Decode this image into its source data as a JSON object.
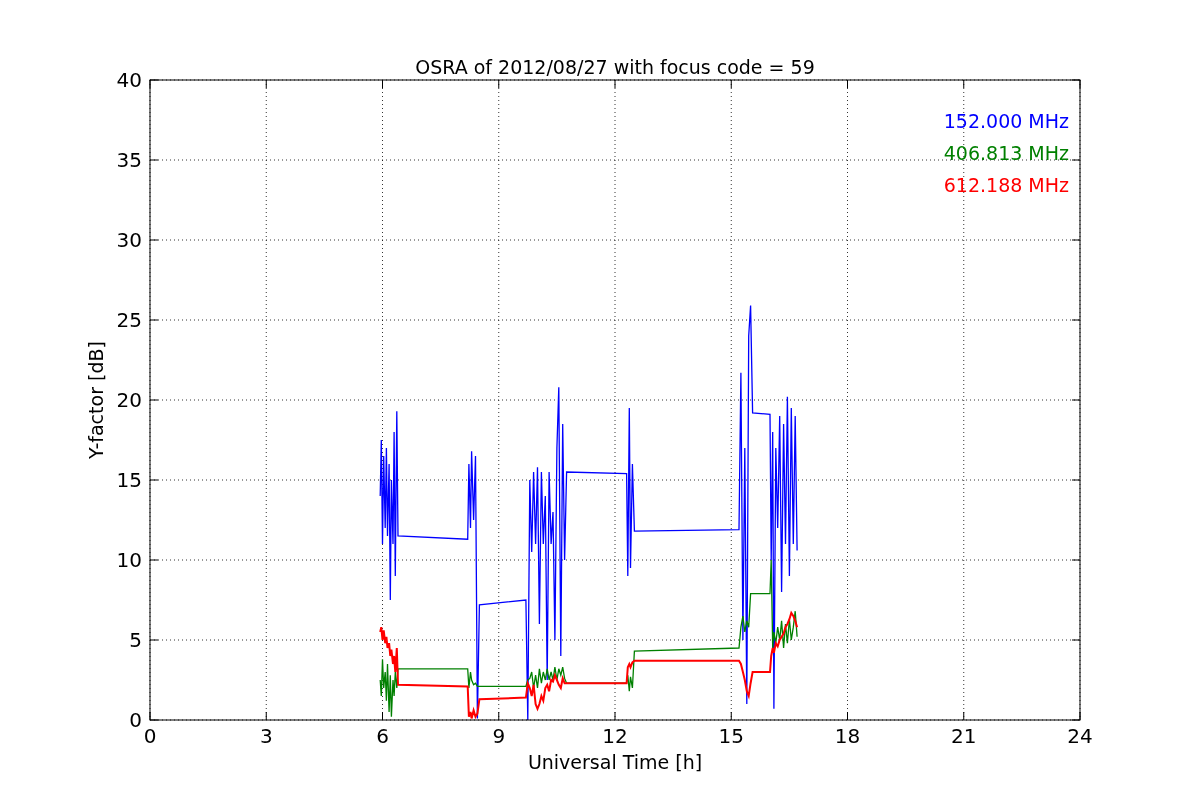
{
  "figure": {
    "chart_data": {
      "type": "line",
      "title": "OSRA of 2012/08/27 with focus code = 59",
      "xlabel": "Universal Time [h]",
      "ylabel": "Y-factor [dB]",
      "xlim": [
        0,
        24
      ],
      "ylim": [
        0,
        40
      ],
      "xticks": [
        0,
        3,
        6,
        9,
        12,
        15,
        18,
        21,
        24
      ],
      "yticks": [
        0,
        5,
        10,
        15,
        20,
        25,
        30,
        35,
        40
      ],
      "grid": true,
      "x": [
        5.94,
        5.97,
        6.0,
        6.03,
        6.07,
        6.1,
        6.13,
        6.17,
        6.2,
        6.23,
        6.27,
        6.3,
        6.33,
        6.37,
        6.4,
        8.2,
        8.23,
        8.27,
        8.3,
        8.35,
        8.4,
        8.45,
        8.5,
        9.7,
        9.75,
        9.8,
        9.85,
        9.9,
        9.95,
        10.0,
        10.05,
        10.1,
        10.15,
        10.2,
        10.25,
        10.3,
        10.35,
        10.4,
        10.45,
        10.5,
        10.55,
        10.6,
        10.65,
        10.7,
        10.75,
        12.3,
        12.33,
        12.37,
        12.4,
        12.45,
        12.5,
        15.2,
        15.25,
        15.3,
        15.35,
        15.4,
        15.45,
        15.5,
        15.55,
        16.0,
        16.03,
        16.07,
        16.1,
        16.15,
        16.2,
        16.25,
        16.3,
        16.35,
        16.4,
        16.45,
        16.5,
        16.55,
        16.6,
        16.65,
        16.7
      ],
      "series": [
        {
          "name": "152.000 MHz",
          "color": "#0000ff",
          "values": [
            14,
            17.5,
            11,
            16.5,
            12,
            17,
            11.5,
            16,
            7.5,
            15,
            11,
            18,
            9,
            19.3,
            11.5,
            11.3,
            16,
            12,
            16.8,
            12.5,
            16.5,
            0.1,
            7.2,
            7.5,
            0,
            15,
            10.5,
            15.5,
            11,
            15.8,
            6,
            15.5,
            11,
            14,
            2.5,
            15.5,
            11,
            13,
            5,
            17,
            20.8,
            4,
            18.5,
            10,
            15.5,
            15.4,
            9,
            19.5,
            9.5,
            16,
            11.8,
            11.9,
            21.7,
            5,
            17,
            1,
            24,
            25.9,
            19.2,
            19.1,
            10,
            18,
            0.7,
            17,
            12,
            19,
            8,
            18.5,
            11,
            20.2,
            9,
            19.5,
            11,
            19,
            10.6
          ]
        },
        {
          "name": "406.813 MHz",
          "color": "#008000",
          "values": [
            2.5,
            1.5,
            3.8,
            2.0,
            3.0,
            1.2,
            3.5,
            0.5,
            2.8,
            0.2,
            2.5,
            1.5,
            3.0,
            2.0,
            3.2,
            3.2,
            2.0,
            3.0,
            2.5,
            2.2,
            2.3,
            2.1,
            2.1,
            2.1,
            2.5,
            2.6,
            3.0,
            2.0,
            2.8,
            2.0,
            3.2,
            2.3,
            3.0,
            2.5,
            3.2,
            2.5,
            3.0,
            2.5,
            3.3,
            2.5,
            3.2,
            2.8,
            3.3,
            2.6,
            2.3,
            2.3,
            2.8,
            1.8,
            2.7,
            2.0,
            4.3,
            4.5,
            5.8,
            6.5,
            5.5,
            6.2,
            5.8,
            7.9,
            7.9,
            7.9,
            10,
            4.5,
            5.5,
            4.8,
            5.8,
            5.0,
            6.2,
            4.5,
            6.0,
            4.8,
            6.3,
            5.0,
            5.8,
            6.8,
            5.2
          ]
        },
        {
          "name": "612.188 MHz",
          "color": "#ff0000",
          "values": [
            5.5,
            5.8,
            5.0,
            5.6,
            4.8,
            5.2,
            4.5,
            4.8,
            4.0,
            4.4,
            3.5,
            4.0,
            3.0,
            4.5,
            2.2,
            2.1,
            0.2,
            0.5,
            0.1,
            0.6,
            0.2,
            0.4,
            1.3,
            1.4,
            2.3,
            2.0,
            1.5,
            2.2,
            1.0,
            0.7,
            1.0,
            1.5,
            1.2,
            2.0,
            2.2,
            1.8,
            2.5,
            2.4,
            2.8,
            2.5,
            2.2,
            2.0,
            2.6,
            2.3,
            2.3,
            2.3,
            3.3,
            3.5,
            3.3,
            3.6,
            3.7,
            3.7,
            3.5,
            3.0,
            2.5,
            1.8,
            1.5,
            2.3,
            3.0,
            3.0,
            4.0,
            4.5,
            4.2,
            4.8,
            4.6,
            5.0,
            5.2,
            5.4,
            5.8,
            6.0,
            6.3,
            6.7,
            6.5,
            6.2,
            5.8
          ]
        }
      ]
    }
  }
}
